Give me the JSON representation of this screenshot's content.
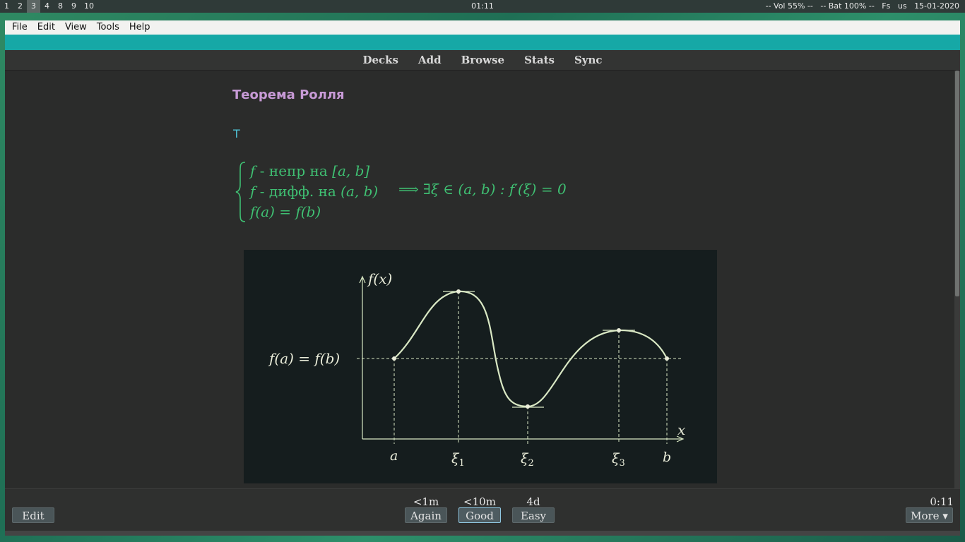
{
  "topbar": {
    "workspaces": [
      "1",
      "2",
      "3",
      "4",
      "8",
      "9",
      "10"
    ],
    "active_workspace": "3",
    "clock": "01:11",
    "volume": "-- Vol 55% --",
    "battery": "-- Bat 100% --",
    "flags": "Fs",
    "layout": "us",
    "date": "15-01-2020"
  },
  "menu": {
    "file": "File",
    "edit": "Edit",
    "view": "View",
    "tools": "Tools",
    "help": "Help"
  },
  "toolbar": {
    "decks": "Decks",
    "add": "Add",
    "browse": "Browse",
    "stats": "Stats",
    "sync": "Sync"
  },
  "card": {
    "title": "Теорема Ролля",
    "letter": "T",
    "formula": {
      "line1_pre": "f",
      "line1_text": " - непр на ",
      "line1_math": "[a, b]",
      "line2_pre": "f",
      "line2_text": " - дифф. на ",
      "line2_math": "(a, b)",
      "line3": "f(a) = f(b)",
      "implication": "⟹  ∃ξ ∈ (a, b) : f′(ξ) = 0"
    },
    "plot": {
      "y_label": "f(x)",
      "x_label": "x",
      "level_label": "f(a) = f(b)",
      "tick_a": "a",
      "tick_xi1": "ξ",
      "tick_xi1_sub": "1",
      "tick_xi2": "ξ",
      "tick_xi2_sub": "2",
      "tick_xi3": "ξ",
      "tick_xi3_sub": "3",
      "tick_b": "b",
      "curve_color": "#d9e8c4"
    }
  },
  "review": {
    "edit": "Edit",
    "again": "Again",
    "again_interval": "<1m",
    "good": "Good",
    "good_interval": "<10m",
    "easy": "Easy",
    "easy_interval": "4d",
    "timer": "0:11",
    "more": "More ▾"
  },
  "colors": {
    "accent_strip": "#16a8a6",
    "title": "#c79ad6",
    "formula": "#3fbf72"
  }
}
